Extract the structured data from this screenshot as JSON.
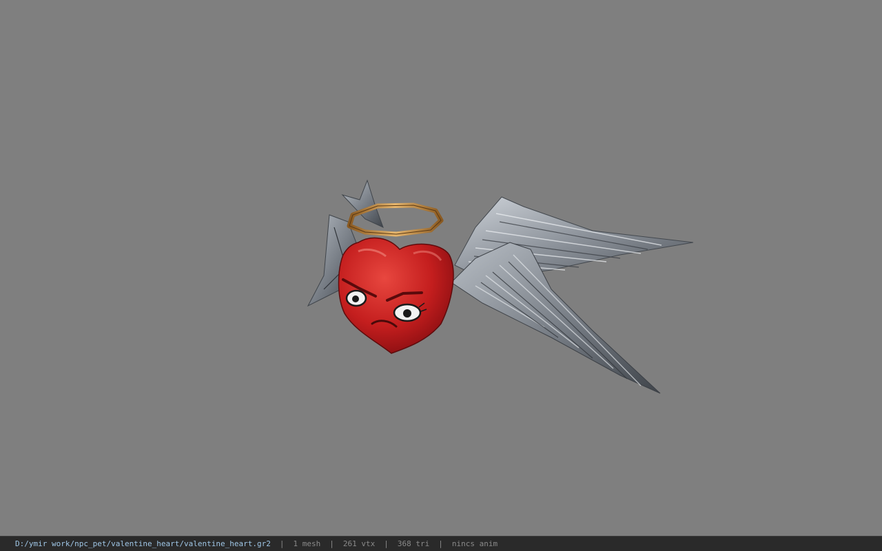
{
  "viewer": {
    "background_color": "#7f7f7f",
    "model": {
      "name": "valentine_heart",
      "icon": "winged-heart-with-halo"
    }
  },
  "status_bar": {
    "file_path": "D:/ymir work/npc_pet/valentine_heart/valentine_heart.gr2",
    "separator": "|",
    "mesh_count": "1 mesh",
    "vertex_count": "261 vtx",
    "triangle_count": "368 tri",
    "anim_status": "nincs anim",
    "path_color": "#9fc6e6",
    "text_color": "#8a8a8a"
  }
}
